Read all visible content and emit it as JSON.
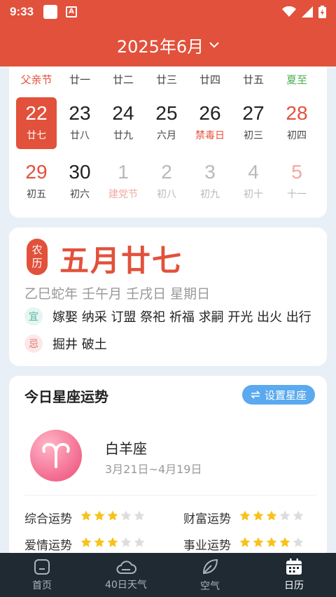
{
  "status_bar": {
    "time": "9:33",
    "a_badge": "A"
  },
  "header": {
    "month_title": "2025年6月"
  },
  "calendar": {
    "holidays": [
      {
        "col": 0,
        "label": "父亲节",
        "color": "red"
      },
      {
        "col": 1,
        "label": "廿一",
        "color": "normal"
      },
      {
        "col": 2,
        "label": "廿二",
        "color": "normal"
      },
      {
        "col": 3,
        "label": "廿三",
        "color": "normal"
      },
      {
        "col": 4,
        "label": "廿四",
        "color": "normal"
      },
      {
        "col": 5,
        "label": "廿五",
        "color": "normal"
      },
      {
        "col": 6,
        "label": "夏至",
        "color": "green"
      }
    ],
    "weeks": [
      [
        {
          "num": "22",
          "sub": "廿七",
          "selected": true
        },
        {
          "num": "23",
          "sub": "廿八"
        },
        {
          "num": "24",
          "sub": "廿九"
        },
        {
          "num": "25",
          "sub": "六月"
        },
        {
          "num": "26",
          "sub": "禁毒日",
          "sub_color": "red"
        },
        {
          "num": "27",
          "sub": "初三"
        },
        {
          "num": "28",
          "sub": "初四",
          "num_color": "red"
        }
      ],
      [
        {
          "num": "29",
          "sub": "初五",
          "num_color": "red"
        },
        {
          "num": "30",
          "sub": "初六"
        },
        {
          "num": "1",
          "sub": "建党节",
          "num_color": "grey",
          "sub_color": "lightred"
        },
        {
          "num": "2",
          "sub": "初八",
          "num_color": "grey",
          "sub_color": "grey"
        },
        {
          "num": "3",
          "sub": "初九",
          "num_color": "grey",
          "sub_color": "grey"
        },
        {
          "num": "4",
          "sub": "初十",
          "num_color": "grey",
          "sub_color": "grey"
        },
        {
          "num": "5",
          "sub": "十一",
          "num_color": "lightred",
          "sub_color": "grey"
        }
      ]
    ]
  },
  "lunar": {
    "badge_top": "农",
    "badge_bottom": "历",
    "date": "五月廿七",
    "ganzhi": "乙巳蛇年 壬午月 壬戌日 星期日",
    "yi_tag": "宜",
    "yi_text": "嫁娶 纳采 订盟 祭祀 祈福 求嗣 开光 出火 出行",
    "ji_tag": "忌",
    "ji_text": "掘井 破土"
  },
  "horoscope": {
    "title": "今日星座运势",
    "set_button": "设置星座",
    "sign_name": "白羊座",
    "sign_range": "3月21日~4月19日",
    "fortunes": [
      {
        "label": "综合运势",
        "stars": 3
      },
      {
        "label": "财富运势",
        "stars": 3
      },
      {
        "label": "爱情运势",
        "stars": 3
      },
      {
        "label": "事业运势",
        "stars": 4
      }
    ]
  },
  "nav": {
    "items": [
      {
        "label": "首页",
        "icon": "home-icon"
      },
      {
        "label": "40日天气",
        "icon": "cloud-icon"
      },
      {
        "label": "空气",
        "icon": "leaf-icon"
      },
      {
        "label": "日历",
        "icon": "calendar-icon",
        "active": true
      }
    ]
  },
  "colors": {
    "accent": "#e2513b",
    "nav_bg": "#1f2a33",
    "star_on": "#f8c21a",
    "star_off": "#dddddd"
  }
}
